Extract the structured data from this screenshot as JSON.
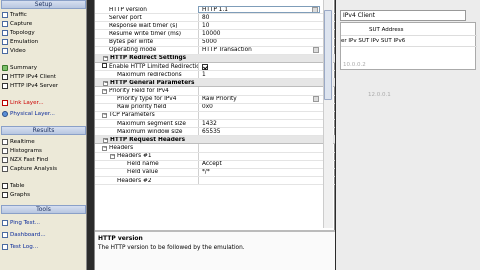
{
  "sidebar": {
    "setup_header": "Setup",
    "setup_items": [
      "Traffic",
      "Capture",
      "Topology",
      "Emulation",
      "Video"
    ],
    "setup_items2": [
      "Summary",
      "HTTP IPv4 Client",
      "HTTP IPv4 Server"
    ],
    "link_items": [
      "Link Layer...",
      "Physical Layer..."
    ],
    "results_header": "Results",
    "results_items": [
      "Realtime",
      "Histograms",
      "NZX Fast Find",
      "Capture Analysis"
    ],
    "view_items": [
      "Table",
      "Graphs"
    ],
    "tools_header": "Tools",
    "tools_items": [
      "Ping Test...",
      "Dashboard...",
      "Test Log..."
    ]
  },
  "main": {
    "rows": [
      {
        "type": "row",
        "key": "HTTP version",
        "value": "HTTP 1.1",
        "dropdown": true,
        "selected": true
      },
      {
        "type": "row",
        "key": "Server port",
        "value": "80"
      },
      {
        "type": "row",
        "key": "Response wait timer (s)",
        "value": "10"
      },
      {
        "type": "row",
        "key": "Resume write timer (ms)",
        "value": "10000"
      },
      {
        "type": "row",
        "key": "Bytes per write",
        "value": "5000"
      },
      {
        "type": "row",
        "key": "Operating mode",
        "value": "HTTP Transaction",
        "dropdown": true
      },
      {
        "type": "sec",
        "key": "HTTP Redirect Settings"
      },
      {
        "type": "row",
        "key": "Enable HTTP Limited Redirections",
        "checkbox": true,
        "checked": true
      },
      {
        "type": "row",
        "key": "Maximum redirections",
        "value": "1",
        "indent": 2
      },
      {
        "type": "sec",
        "key": "HTTP General Parameters"
      },
      {
        "type": "row",
        "key": "Priority Field for IPv4",
        "tree": true
      },
      {
        "type": "row",
        "key": "Priority type for IPv4",
        "value": "Raw Priority",
        "dropdown": true,
        "indent": 2
      },
      {
        "type": "row",
        "key": "Raw priority field",
        "value": "0x0",
        "indent": 2
      },
      {
        "type": "row",
        "key": "TCP Parameters",
        "tree": true
      },
      {
        "type": "row",
        "key": "Maximum segment size",
        "value": "1432",
        "indent": 2
      },
      {
        "type": "row",
        "key": "Maximum window size",
        "value": "65535",
        "indent": 2
      },
      {
        "type": "sec",
        "key": "HTTP Request Headers"
      },
      {
        "type": "row",
        "key": "Headers",
        "tree": true
      },
      {
        "type": "row",
        "key": "Headers #1",
        "tree": true,
        "indent": 2
      },
      {
        "type": "row",
        "key": "Field name",
        "value": "Accept",
        "indent": 3
      },
      {
        "type": "row",
        "key": "Field value",
        "value": "*/*",
        "indent": 3
      },
      {
        "type": "row",
        "key": "Headers #2",
        "indent": 2
      }
    ],
    "help_title": "HTTP version",
    "help_text": "The HTTP version to be followed by the emulation."
  },
  "right": {
    "tab": "IPv4 Client",
    "col_header1": "SUT Address",
    "col_header2": "er IPv SUT IPv SUT IPv6",
    "faint1": "10.0.0.2",
    "faint2": "12.0.0.1"
  }
}
